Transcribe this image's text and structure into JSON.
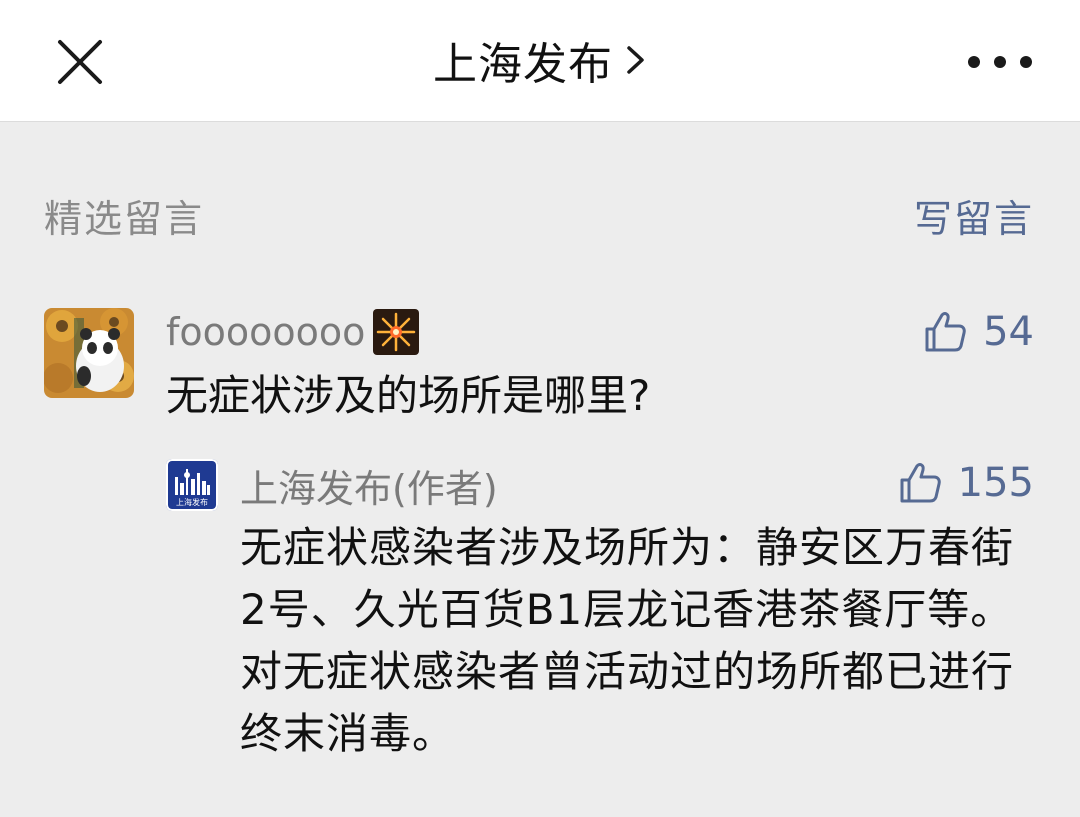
{
  "nav": {
    "title": "上海发布",
    "close_icon": "close-icon",
    "chevron_icon": "chevron-right-icon",
    "more_icon": "more-horizontal-icon"
  },
  "section": {
    "title": "精选留言",
    "write_label": "写留言"
  },
  "comment": {
    "username": "foooooooo",
    "badge_icon": "firework-icon",
    "text": "无症状涉及的场所是哪里?",
    "likes": "54",
    "like_icon": "thumbs-up-icon"
  },
  "reply": {
    "author": "上海发布(作者)",
    "avatar_label": "上海发布",
    "text": "无症状感染者涉及场所为：静安区万春街2号、久光百货B1层龙记香港茶餐厅等。对无症状感染者曾活动过的场所都已进行终末消毒。",
    "likes": "155",
    "like_icon": "thumbs-up-icon"
  },
  "colors": {
    "accent": "#566a93",
    "background": "#ededed",
    "secondary_text": "#7a7a7a"
  }
}
